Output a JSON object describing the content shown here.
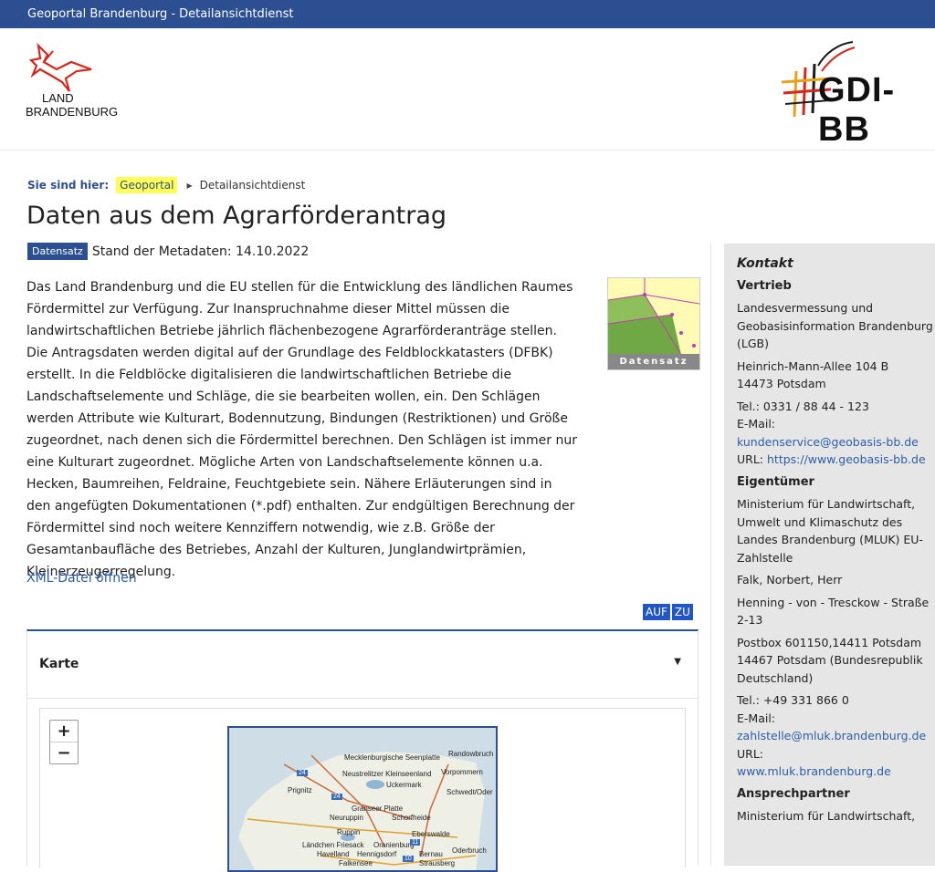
{
  "topbar": {
    "title": "Geoportal Brandenburg - Detailansichtdienst"
  },
  "logos": {
    "left_line1": "LAND",
    "left_line2": "BRANDENBURG",
    "right_text": "GDI-BB"
  },
  "breadcrumb": {
    "label": "Sie sind hier:",
    "home": "Geoportal",
    "current": "Detailansichtdienst"
  },
  "page": {
    "title": "Daten aus dem Agrarförderantrag",
    "badge": "Datensatz",
    "meta_date": "Stand der Metadaten: 14.10.2022",
    "description": "Das Land Brandenburg und die EU stellen für die Entwicklung des ländlichen Raumes Fördermittel zur Verfügung. Zur Inanspruchnahme dieser Mittel müssen die landwirtschaftlichen Betriebe jährlich flächenbezogene Agrarförderanträge stellen. Die Antragsdaten werden digital auf der Grundlage des Feldblockkatasters (DFBK) erstellt. In die Feldblöcke digitalisieren die landwirtschaftlichen Betriebe die Landschaftselemente und Schläge, die sie bearbeiten wollen, ein. Den Schlägen werden Attribute wie Kulturart, Bodennutzung, Bindungen (Restriktionen) und Größe zugeordnet, nach denen sich die Fördermittel berechnen. Den Schlägen ist immer nur eine Kulturart zugeordnet. Mögliche Arten von Landschaftselemente können u.a. Hecken, Baumreihen, Feldraine, Feuchtgebiete sein. Nähere Erläuterungen sind in den angefügten Dokumentationen (*.pdf) enthalten. Zur endgültigen Berechnung der Fördermittel sind noch weitere Kennziffern notwendig, wie z.B. Größe der Gesamtanbaufläche des Betriebes, Anzahl der Kulturen, Junglandwirtprämien, Kleinerzeugerregelung.",
    "thumb_label": "Datensatz",
    "xml_link": "XML-Datei öffnen",
    "auf": "AUF",
    "zu": "ZU"
  },
  "karte": {
    "title": "Karte",
    "zoom_in": "+",
    "zoom_out": "−",
    "map_labels": [
      "Mecklenburgische Seenplatte",
      "Neustrelitzer Kleinseenland",
      "Randowbruch",
      "Vorpommern",
      "Uckermark",
      "Schwedt/Oder",
      "Prignitz",
      "Granseer Platte",
      "Neuruppin",
      "Schorfheide",
      "Ruppin",
      "Eberswalde",
      "Ländchen Friesack",
      "Oranienburg",
      "Havelland",
      "Hennigsdorf",
      "Bernau",
      "Strausberg",
      "Falkensee",
      "Oderbruch"
    ],
    "road_shields": [
      "24",
      "24",
      "11",
      "10"
    ]
  },
  "sidebar": {
    "heading": "Kontakt",
    "vertrieb": {
      "title": "Vertrieb",
      "org": "Landesvermessung und Geobasisinformation Brandenburg (LGB)",
      "street": "Heinrich-Mann-Allee 104 B",
      "city": "14473 Potsdam",
      "tel": "Tel.: 0331 / 88 44 - 123",
      "email_label": "E-Mail:",
      "email": "kundenservice@geobasis-bb.de",
      "url_label": "URL:",
      "url": "https://www.geobasis-bb.de"
    },
    "eigentuemer": {
      "title": "Eigentümer",
      "org": "Ministerium für Landwirtschaft, Umwelt und Klimaschutz des Landes Brandenburg (MLUK) EU-Zahlstelle",
      "person": "Falk, Norbert, Herr",
      "street": "Henning - von - Tresckow - Straße 2-13",
      "postbox": "Postbox 601150,14411 Potsdam",
      "city": "14467 Potsdam (Bundesrepublik Deutschland)",
      "tel": "Tel.: +49 331 866 0",
      "email_label": "E-Mail:",
      "email": "zahlstelle@mluk.brandenburg.de",
      "url_label": "URL:",
      "url": "www.mluk.brandenburg.de"
    },
    "ansprechpartner": {
      "title": "Ansprechpartner",
      "org": "Ministerium für Landwirtschaft,"
    }
  }
}
